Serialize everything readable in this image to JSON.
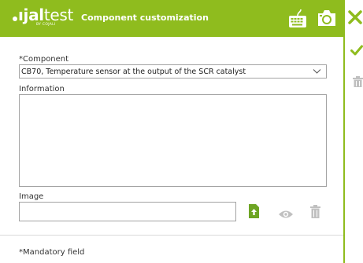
{
  "colors": {
    "accent": "#8fbc1e",
    "icon_grey": "#c0c0c0"
  },
  "header": {
    "logo_bold": "ıjal",
    "logo_light": "test",
    "logo_sub": "BY COJALI",
    "title": "Component customization"
  },
  "icons": {
    "keyboard": "keyboard-icon",
    "camera": "camera-icon",
    "close": "close-icon",
    "confirm": "check-icon",
    "delete": "trash-icon",
    "upload": "upload-icon",
    "view": "eye-icon"
  },
  "form": {
    "component_label": "*Component",
    "component_value": "CB70, Temperature sensor at the output of the SCR catalyst",
    "information_label": "Information",
    "information_value": "",
    "image_label": "Image",
    "image_value": ""
  },
  "footer": {
    "mandatory_note": "*Mandatory field"
  }
}
